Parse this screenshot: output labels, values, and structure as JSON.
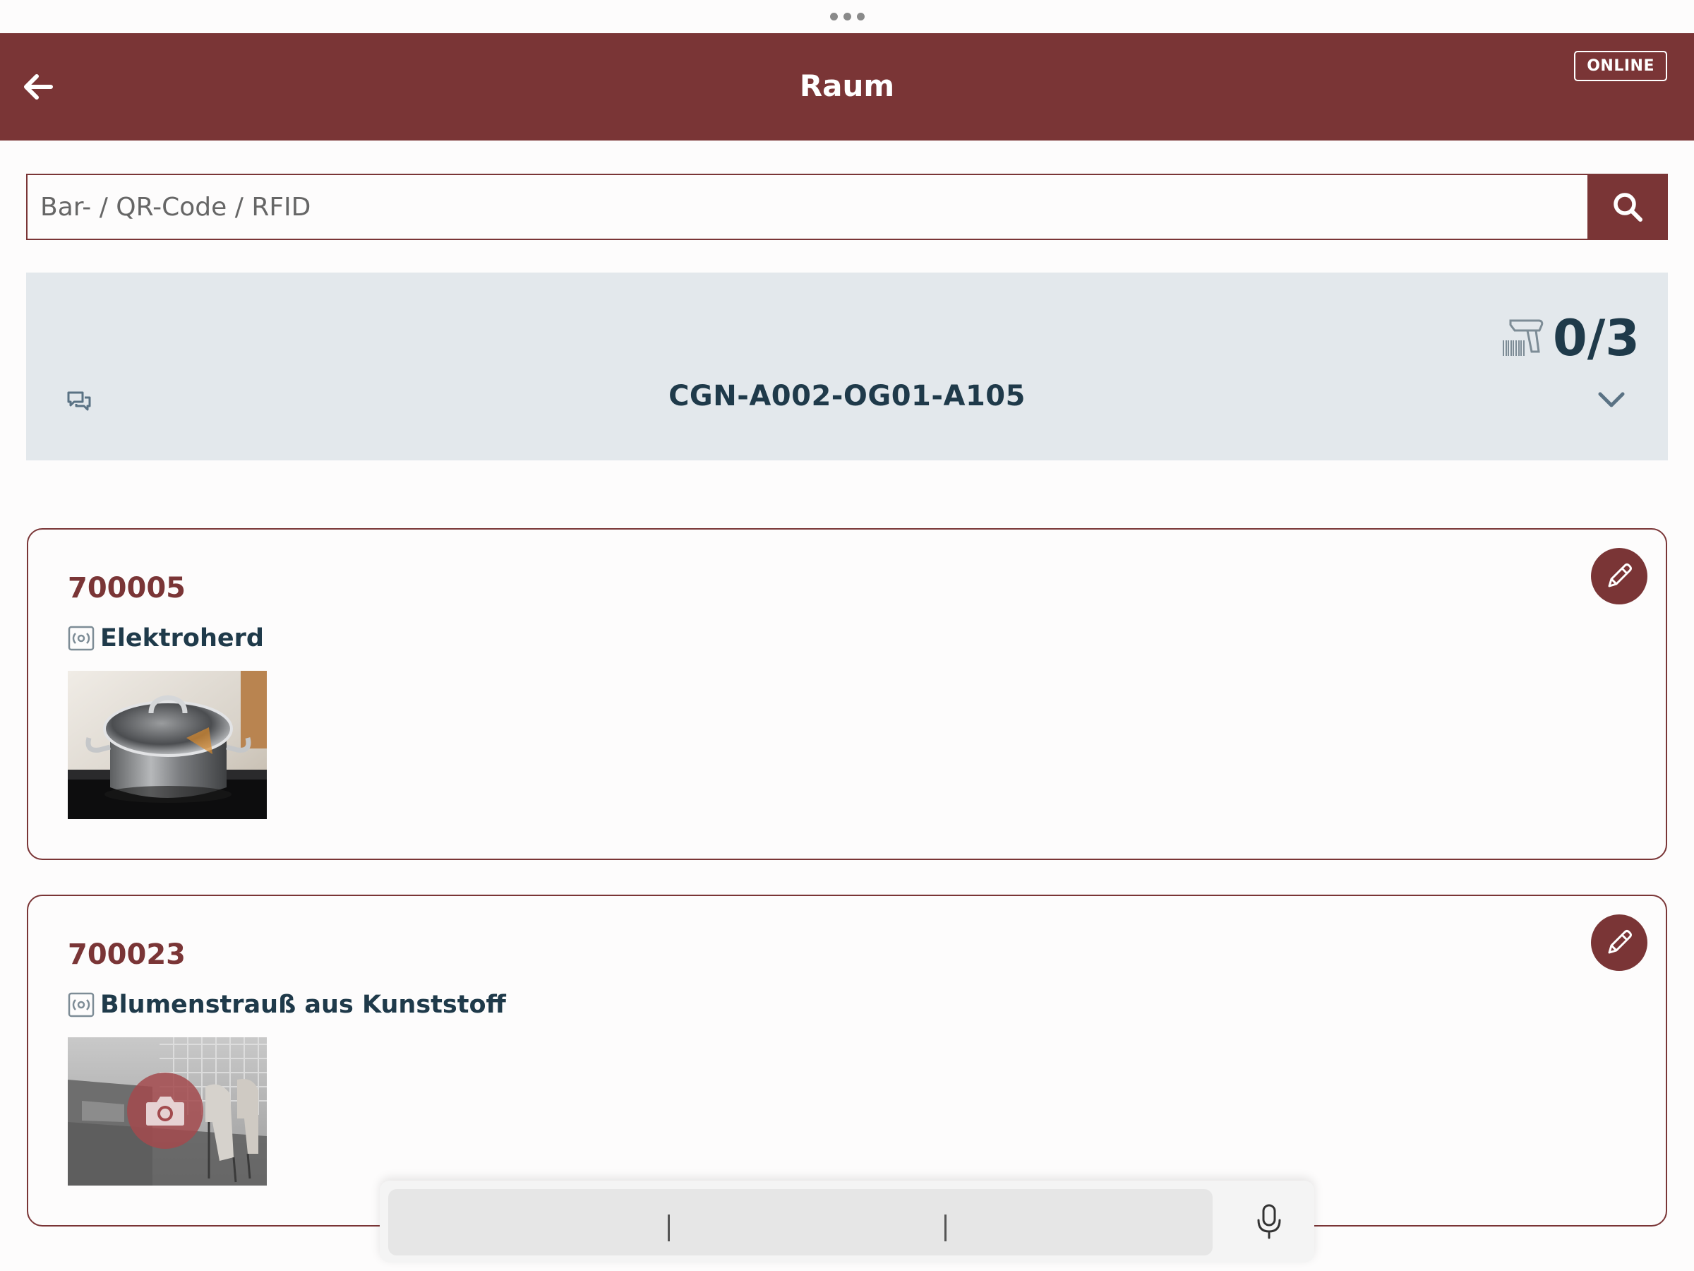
{
  "window": {
    "dots_icon": "more-dots-icon"
  },
  "appbar": {
    "title": "Raum",
    "status_badge": "ONLINE",
    "back_icon": "arrow-left-icon",
    "background_color": "#7a3536"
  },
  "search": {
    "placeholder": "Bar- / QR-Code / RFID",
    "value": "",
    "button_icon": "search-icon"
  },
  "room": {
    "code": "CGN-A002-OG01-A105",
    "scan_count": "0/3",
    "scan_icon": "barcode-scanner-icon",
    "comment_icon": "comments-icon",
    "expand_icon": "chevron-down-icon"
  },
  "items": [
    {
      "id": "700005",
      "type_label": "Elektroherd",
      "type_icon": "rfid-tag-icon",
      "image": "cooking-pot-photo",
      "edit_icon": "pencil-icon"
    },
    {
      "id": "700023",
      "type_label": "Blumenstrauß aus Kunststoff",
      "type_icon": "rfid-tag-icon",
      "image": "room-placeholder-photo",
      "image_overlay_icon": "camera-icon",
      "edit_icon": "pencil-icon"
    }
  ],
  "input_bar": {
    "mic_icon": "microphone-icon"
  }
}
